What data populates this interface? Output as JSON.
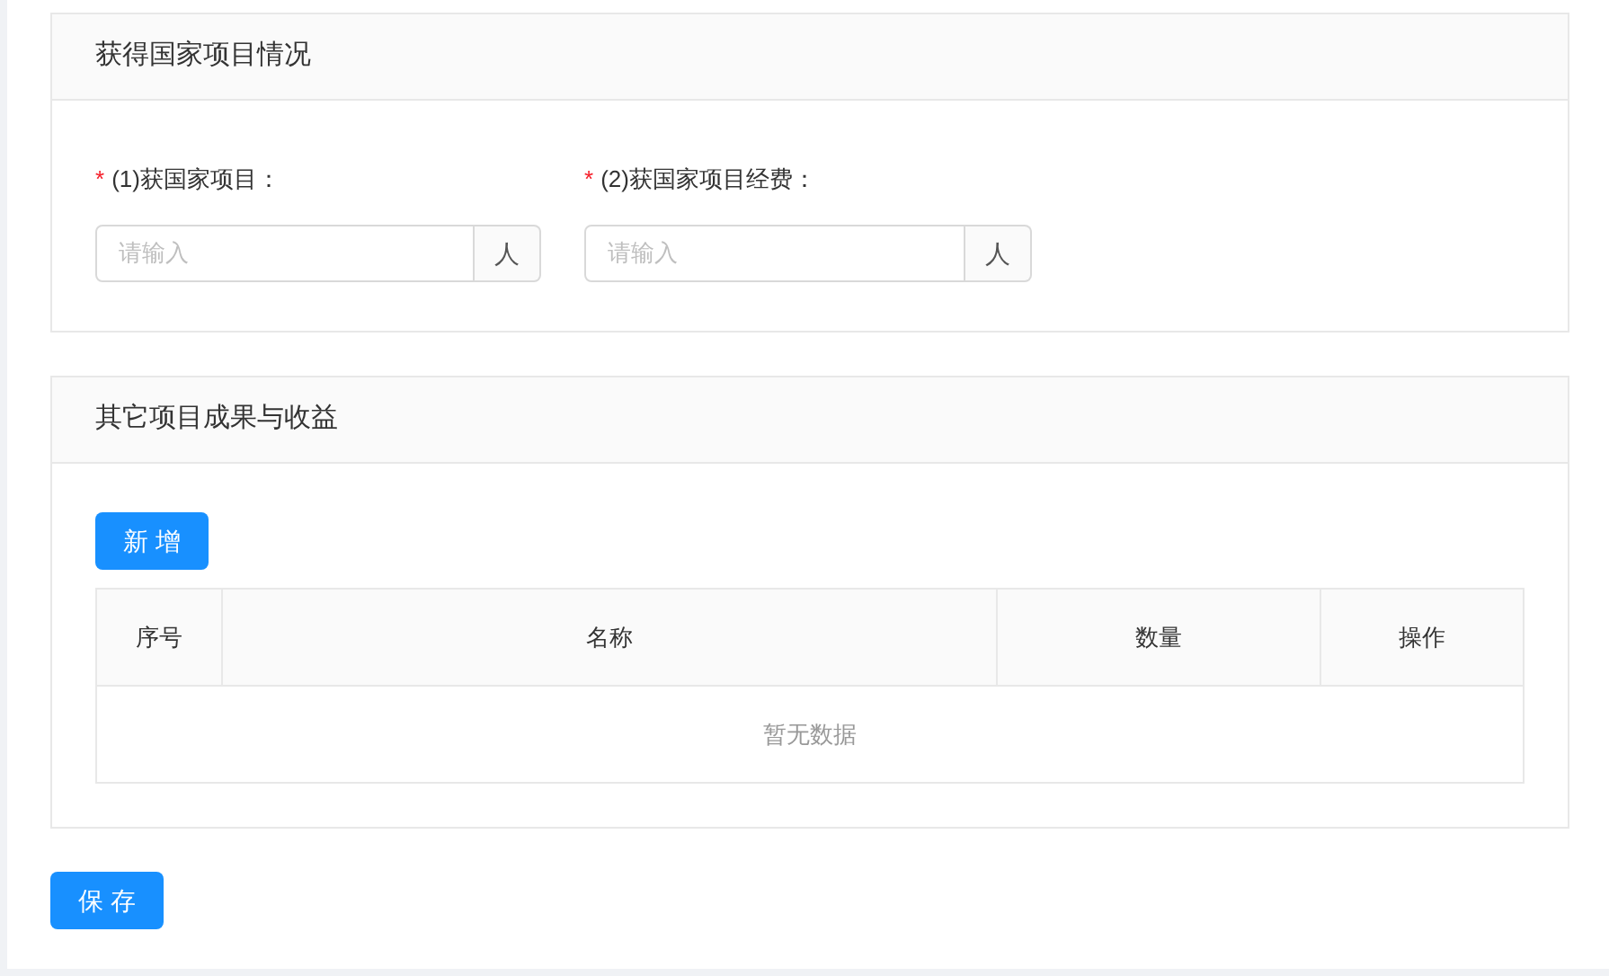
{
  "sections": [
    {
      "title": "获得国家项目情况",
      "kind": "form",
      "fields": [
        {
          "required_mark": "*",
          "label": "(1)获国家项目：",
          "placeholder": "请输入",
          "suffix": "人"
        },
        {
          "required_mark": "*",
          "label": "(2)获国家项目经费：",
          "placeholder": "请输入",
          "suffix": "人"
        }
      ]
    },
    {
      "title": "其它项目成果与收益",
      "kind": "table",
      "add_button": "新增",
      "table": {
        "columns": [
          "序号",
          "名称",
          "数量",
          "操作"
        ],
        "empty_text": "暂无数据"
      }
    }
  ],
  "save_button": "保存"
}
